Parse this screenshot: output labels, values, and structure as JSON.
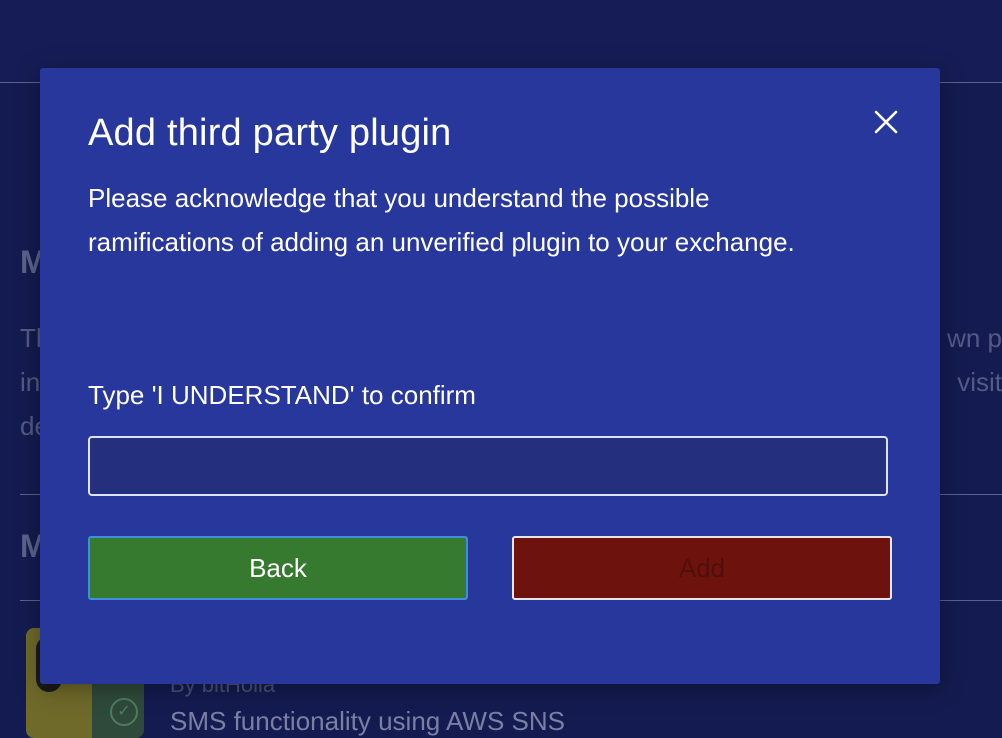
{
  "background": {
    "heading_1_partial": "M",
    "heading_2_partial": "M",
    "text_left_lines": [
      "Th",
      "in",
      "de"
    ],
    "text_right_lines": [
      "wn p",
      "visit"
    ],
    "card": {
      "by": "By bitHolla",
      "description": "SMS functionality using AWS SNS"
    }
  },
  "modal": {
    "title": "Add third party plugin",
    "description": "Please acknowledge that you understand the possible ramifications of adding an unverified plugin to your exchange.",
    "confirm_label": "Type 'I UNDERSTAND' to confirm",
    "confirm_input": {
      "value": "",
      "placeholder": ""
    },
    "back_label": "Back",
    "add_label": "Add",
    "close_icon": "close-icon"
  },
  "colors": {
    "modal_bg": "#27379c",
    "back_button": "#357a2f",
    "add_button": "#6e120d",
    "page_bg": "#141b50"
  }
}
